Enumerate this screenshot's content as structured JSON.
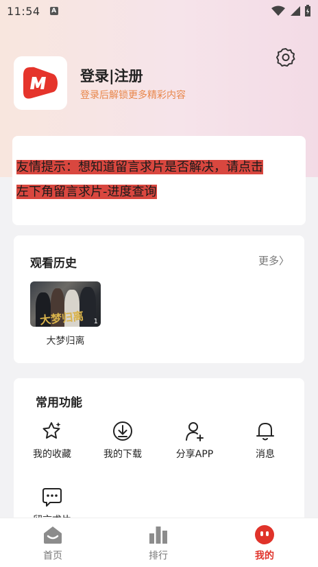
{
  "status_bar": {
    "time": "11:54",
    "a_badge": "A"
  },
  "profile": {
    "login_title": "登录|注册",
    "login_subtitle": "登录后解锁更多精彩内容"
  },
  "notice": {
    "line1": "友情提示：想知道留言求片是否解决，请点击",
    "line2": "左下角留言求片-进度查询"
  },
  "history": {
    "title": "观看历史",
    "more": "更多〉",
    "items": [
      {
        "title": "大梦归离",
        "episode": "1",
        "poster_text": "大梦归离"
      }
    ]
  },
  "functions": {
    "title": "常用功能",
    "items": [
      {
        "label": "我的收藏",
        "icon": "star-icon"
      },
      {
        "label": "我的下载",
        "icon": "download-icon"
      },
      {
        "label": "分享APP",
        "icon": "share-user-icon"
      },
      {
        "label": "消息",
        "icon": "bell-icon"
      },
      {
        "label": "留言求片",
        "icon": "message-icon"
      }
    ]
  },
  "tabbar": {
    "tabs": [
      {
        "label": "首页",
        "icon": "home-icon"
      },
      {
        "label": "排行",
        "icon": "ranking-icon"
      },
      {
        "label": "我的",
        "icon": "profile-face-icon",
        "active": true
      }
    ]
  },
  "colors": {
    "accent": "#e0332a",
    "notice_highlight": "#d9473f",
    "subtitle": "#e8864a"
  }
}
